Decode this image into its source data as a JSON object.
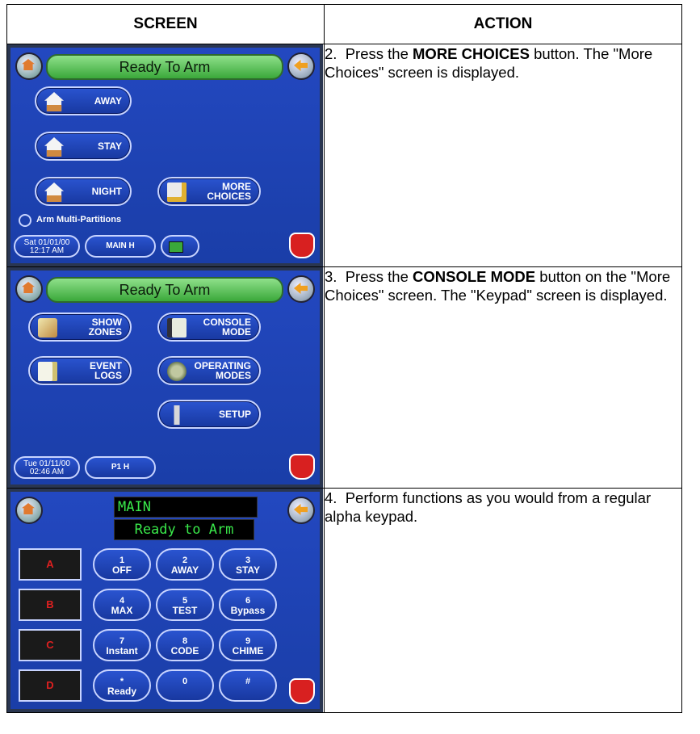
{
  "table": {
    "header_screen": "SCREEN",
    "header_action": "ACTION"
  },
  "rows": [
    {
      "step": "2.",
      "action_before": "Press the ",
      "action_bold": "MORE CHOICES",
      "action_after": " button. The \"More Choices\" screen is displayed."
    },
    {
      "step": "3.",
      "action_before": "Press the ",
      "action_bold": "CONSOLE MODE",
      "action_after": " button on the \"More Choices\" screen.  The \"Keypad\" screen is displayed."
    },
    {
      "step": "4.",
      "action_before": "Perform functions as you would from a regular alpha keypad.",
      "action_bold": "",
      "action_after": ""
    }
  ],
  "screen1": {
    "status": "Ready To Arm",
    "away": "AWAY",
    "stay": "STAY",
    "night": "NIGHT",
    "more_line1": "MORE",
    "more_line2": "CHOICES",
    "arm_multi": "Arm Multi-Partitions",
    "date_line1": "Sat 01/01/00",
    "date_line2": "12:17 AM",
    "partition": "MAIN H"
  },
  "screen2": {
    "status": "Ready To Arm",
    "show_zones_1": "SHOW",
    "show_zones_2": "ZONES",
    "console_1": "CONSOLE",
    "console_2": "MODE",
    "event_1": "EVENT",
    "event_2": "LOGS",
    "operating_1": "OPERATING",
    "operating_2": "MODES",
    "setup": "SETUP",
    "date_line1": "Tue 01/11/00",
    "date_line2": "02:46 AM",
    "partition": "P1 H"
  },
  "screen3": {
    "lcd_line1": "MAIN",
    "lcd_line2": "Ready to Arm",
    "keys_side": [
      "A",
      "B",
      "C",
      "D"
    ],
    "keys": [
      {
        "n": "1",
        "t": "OFF"
      },
      {
        "n": "2",
        "t": "AWAY"
      },
      {
        "n": "3",
        "t": "STAY"
      },
      {
        "n": "4",
        "t": "MAX"
      },
      {
        "n": "5",
        "t": "TEST"
      },
      {
        "n": "6",
        "t": "Bypass"
      },
      {
        "n": "7",
        "t": "Instant"
      },
      {
        "n": "8",
        "t": "CODE"
      },
      {
        "n": "9",
        "t": "CHIME"
      },
      {
        "n": "*",
        "t": "Ready"
      },
      {
        "n": "0",
        "t": ""
      },
      {
        "n": "#",
        "t": ""
      }
    ]
  }
}
